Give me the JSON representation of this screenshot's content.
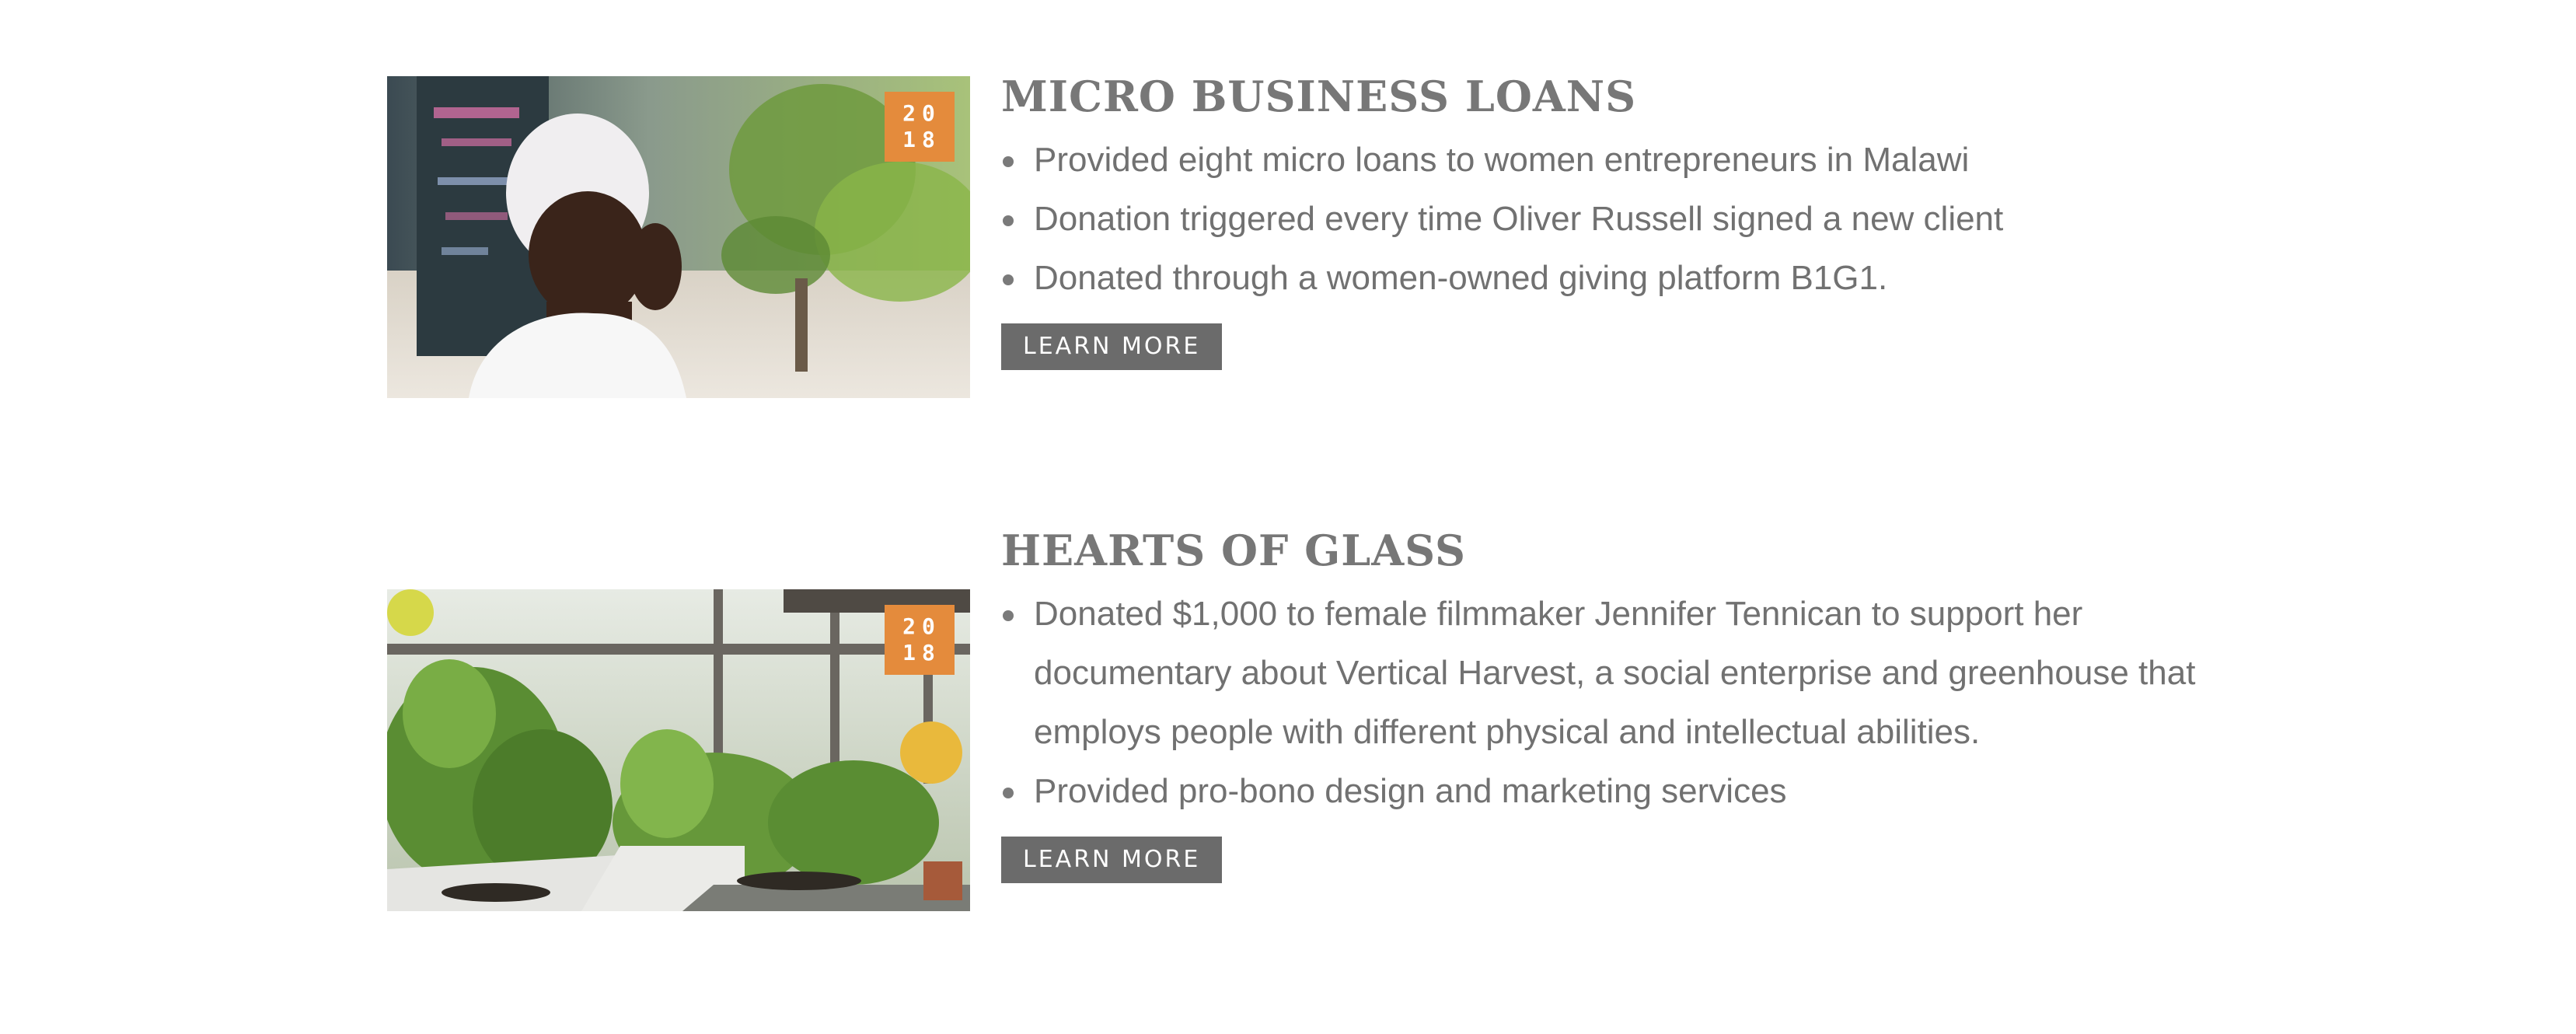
{
  "entries": [
    {
      "title": "MICRO BUSINESS LOANS",
      "badge": {
        "line1": "20",
        "line2": "18"
      },
      "image": "woman-smiling-photo",
      "bullets": [
        "Provided eight micro loans to women entrepreneurs in Malawi",
        "Donation triggered every time Oliver Russell signed a new client",
        "Donated through a women-owned giving platform B1G1."
      ],
      "button_label": "LEARN MORE"
    },
    {
      "title": "HEARTS OF GLASS",
      "badge": {
        "line1": "20",
        "line2": "18"
      },
      "image": "greenhouse-plants-photo",
      "bullets": [
        "Donated $1,000 to female filmmaker Jennifer Tennican to support her documentary about Vertical Harvest, a social enterprise and greenhouse that employs people with different physical and intellectual abilities.",
        "Provided pro-bono design and marketing services"
      ],
      "button_label": "LEARN MORE"
    }
  ],
  "colors": {
    "badge": "#e48b3c",
    "button": "#6b6b6b",
    "text": "#717171",
    "title": "#777777"
  }
}
